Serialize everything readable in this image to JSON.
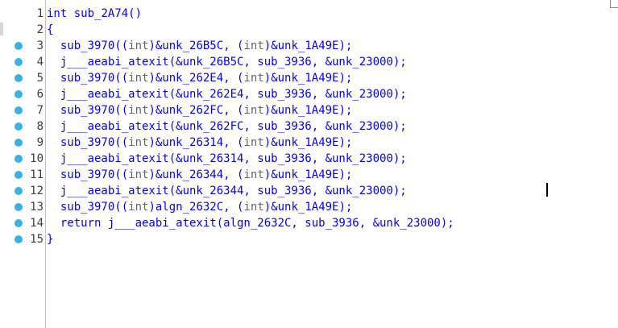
{
  "editor": {
    "lines": [
      {
        "no": "1",
        "bp": false,
        "pre": "",
        "kw": "int",
        "rest": " sub_2A74()"
      },
      {
        "no": "2",
        "bp": false,
        "pre": "",
        "kw": "",
        "rest": "{"
      },
      {
        "no": "3",
        "bp": true,
        "pre": "  sub_3970((",
        "kw": "int",
        "rest": ")&unk_26B5C, (",
        "kw2": "int",
        "rest2": ")&unk_1A49E);"
      },
      {
        "no": "4",
        "bp": true,
        "pre": "  j___aeabi_atexit(&unk_26B5C, sub_3936, &unk_23000);",
        "kw": "",
        "rest": ""
      },
      {
        "no": "5",
        "bp": true,
        "pre": "  sub_3970((",
        "kw": "int",
        "rest": ")&unk_262E4, (",
        "kw2": "int",
        "rest2": ")&unk_1A49E);"
      },
      {
        "no": "6",
        "bp": true,
        "pre": "  j___aeabi_atexit(&unk_262E4, sub_3936, &unk_23000);",
        "kw": "",
        "rest": ""
      },
      {
        "no": "7",
        "bp": true,
        "pre": "  sub_3970((",
        "kw": "int",
        "rest": ")&unk_262FC, (",
        "kw2": "int",
        "rest2": ")&unk_1A49E);"
      },
      {
        "no": "8",
        "bp": true,
        "pre": "  j___aeabi_atexit(&unk_262FC, sub_3936, &unk_23000);",
        "kw": "",
        "rest": ""
      },
      {
        "no": "9",
        "bp": true,
        "pre": "  sub_3970((",
        "kw": "int",
        "rest": ")&unk_26314, (",
        "kw2": "int",
        "rest2": ")&unk_1A49E);"
      },
      {
        "no": "10",
        "bp": true,
        "pre": "  j___aeabi_atexit(&unk_26314, sub_3936, &unk_23000);",
        "kw": "",
        "rest": ""
      },
      {
        "no": "11",
        "bp": true,
        "pre": "  sub_3970((",
        "kw": "int",
        "rest": ")&unk_26344, (",
        "kw2": "int",
        "rest2": ")&unk_1A49E);"
      },
      {
        "no": "12",
        "bp": true,
        "pre": "  j___aeabi_atexit(&unk_26344, sub_3936, &unk_23000);",
        "kw": "",
        "rest": ""
      },
      {
        "no": "13",
        "bp": true,
        "pre": "  sub_3970((",
        "kw": "int",
        "rest": ")algn_2632C, (",
        "kw2": "int",
        "rest2": ")&unk_1A49E);"
      },
      {
        "no": "14",
        "bp": true,
        "pre": "  return j___aeabi_atexit(algn_2632C, sub_3936, &unk_23000);",
        "kw": "",
        "rest": ""
      },
      {
        "no": "15",
        "bp": true,
        "pre": "",
        "kw": "",
        "rest": "}"
      }
    ]
  }
}
